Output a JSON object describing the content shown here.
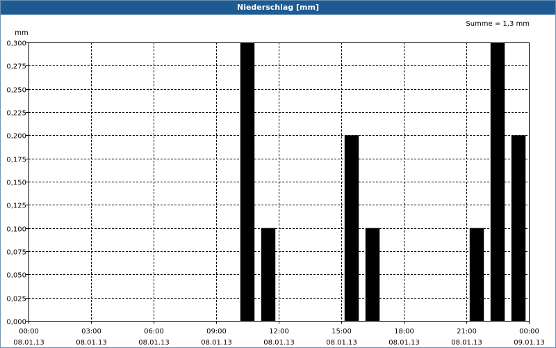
{
  "window": {
    "title": "Niederschlag [mm]"
  },
  "chart_data": {
    "type": "bar",
    "title": "Niederschlag [mm]",
    "ylabel": "mm",
    "annotation": "Summe = 1,3 mm",
    "ylim": [
      0,
      0.3
    ],
    "y_ticks": [
      0,
      0.025,
      0.05,
      0.075,
      0.1,
      0.125,
      0.15,
      0.175,
      0.2,
      0.225,
      0.25,
      0.275,
      0.3
    ],
    "y_tick_labels": [
      "0,000",
      "0,025",
      "0,050",
      "0,075",
      "0,100",
      "0,125",
      "0,150",
      "0,175",
      "0,200",
      "0,225",
      "0,250",
      "0,275",
      "0,300"
    ],
    "x_ticks": [
      {
        "time": "00:00",
        "date": "08.01.13"
      },
      {
        "time": "03:00",
        "date": "08.01.13"
      },
      {
        "time": "06:00",
        "date": "08.01.13"
      },
      {
        "time": "09:00",
        "date": "08.01.13"
      },
      {
        "time": "12:00",
        "date": "08.01.13"
      },
      {
        "time": "15:00",
        "date": "08.01.13"
      },
      {
        "time": "18:00",
        "date": "08.01.13"
      },
      {
        "time": "21:00",
        "date": "08.01.13"
      },
      {
        "time": "00:00",
        "date": "09.01.13"
      }
    ],
    "grid": true,
    "bar_color": "#000000",
    "bars": [
      {
        "hour": 10,
        "value": 0.3
      },
      {
        "hour": 11,
        "value": 0.1
      },
      {
        "hour": 15,
        "value": 0.2
      },
      {
        "hour": 16,
        "value": 0.1
      },
      {
        "hour": 21,
        "value": 0.1
      },
      {
        "hour": 22,
        "value": 0.3
      },
      {
        "hour": 23,
        "value": 0.2
      }
    ]
  }
}
